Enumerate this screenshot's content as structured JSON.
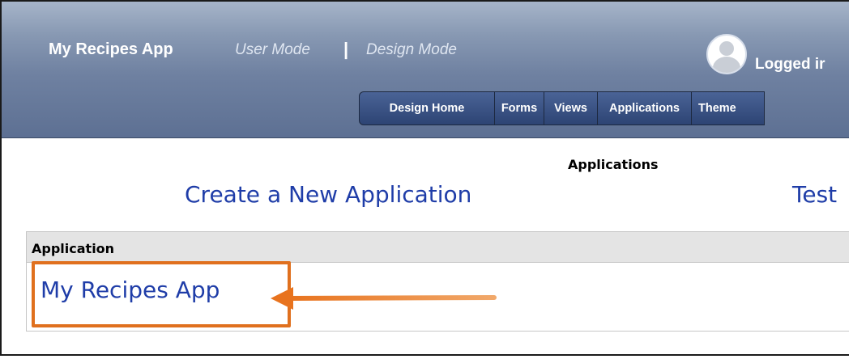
{
  "header": {
    "app_name": "My Recipes App",
    "user_mode": "User Mode",
    "separator": "|",
    "design_mode": "Design Mode",
    "logged_text": "Logged ir"
  },
  "nav": {
    "tabs": [
      {
        "label": "Design Home"
      },
      {
        "label": "Forms"
      },
      {
        "label": "Views"
      },
      {
        "label": "Applications"
      },
      {
        "label": "Theme"
      }
    ]
  },
  "main": {
    "section_title": "Applications",
    "create_link": "Create a New Application",
    "test_link": "Test",
    "table": {
      "column_header": "Application",
      "rows": [
        {
          "name": "My Recipes App"
        }
      ]
    }
  },
  "colors": {
    "accent": "#e0701e",
    "link": "#1f3da8",
    "tab_bg": "#2d4474",
    "header_bg": "#8899b3"
  },
  "icons": {
    "avatar": "user-avatar-icon",
    "annotation": "arrow-left-icon"
  }
}
